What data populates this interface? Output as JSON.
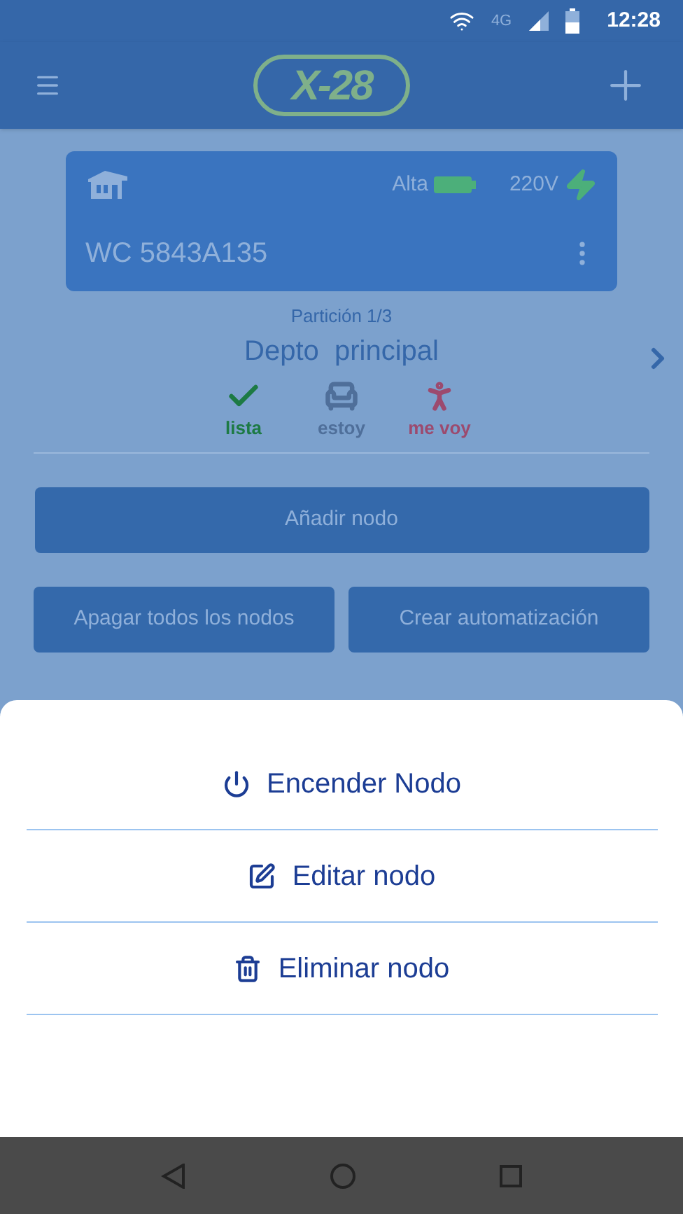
{
  "status_bar": {
    "network": "4G",
    "time": "12:28"
  },
  "app_bar": {
    "logo": "X-28"
  },
  "device": {
    "signal": "Alta",
    "voltage": "220V",
    "name": "WC 5843A135"
  },
  "partition": {
    "label": "Partición 1/3",
    "name": "Depto  principal"
  },
  "modes": [
    {
      "kind": "check",
      "label": "lista",
      "color": "#1d7a44"
    },
    {
      "kind": "seat",
      "label": "estoy",
      "color": "#4f6f9a"
    },
    {
      "kind": "walk",
      "label": "me voy",
      "color": "#9c4a6e"
    }
  ],
  "buttons": [
    "Añadir nodo",
    "Apagar todos los nodos",
    "Crear automatización"
  ],
  "sheet": [
    {
      "kind": "power",
      "label": "Encender Nodo"
    },
    {
      "kind": "edit",
      "label": "Editar nodo"
    },
    {
      "kind": "trash",
      "label": "Eliminar nodo"
    }
  ]
}
